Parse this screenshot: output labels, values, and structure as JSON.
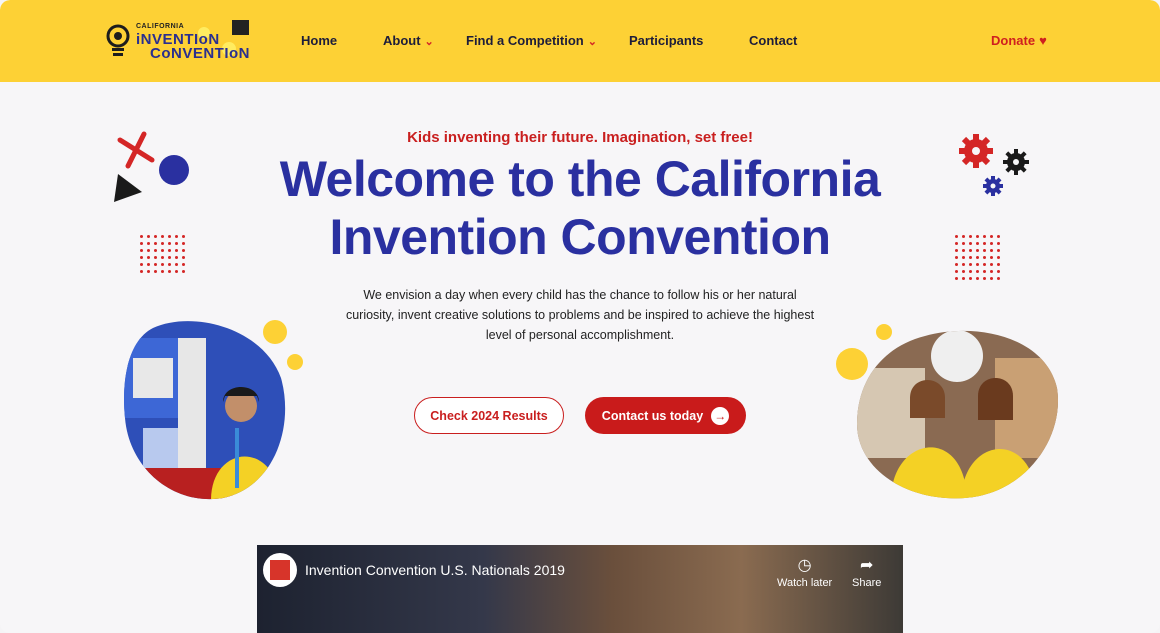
{
  "logo": {
    "line_small": "CALIFORNIA",
    "line1": "iNVENTIoN",
    "line2": "CoNVENTIoN"
  },
  "nav": {
    "home": "Home",
    "about": "About",
    "find": "Find a Competition",
    "participants": "Participants",
    "contact": "Contact",
    "donate": "Donate"
  },
  "hero": {
    "tagline": "Kids inventing their future. Imagination, set free!",
    "title_line1": "Welcome to the California",
    "title_line2": "Invention Convention",
    "description": "We envision a day when every child has the chance to follow his or her natural curiosity, invent creative solutions to problems and be inspired to achieve the highest level of personal accomplishment.",
    "btn_results": "Check 2024 Results",
    "btn_contact": "Contact us today"
  },
  "video": {
    "title": "Invention Convention U.S. Nationals 2019",
    "watch_later": "Watch later",
    "share": "Share"
  },
  "colors": {
    "brand_yellow": "#fdd135",
    "brand_blue": "#2a30a0",
    "brand_red": "#c91f1f"
  },
  "icons": [
    "lightbulb-logo-icon",
    "chevron-down-icon",
    "heart-icon",
    "arrow-right-icon",
    "clock-icon",
    "share-icon",
    "gear-icon"
  ]
}
